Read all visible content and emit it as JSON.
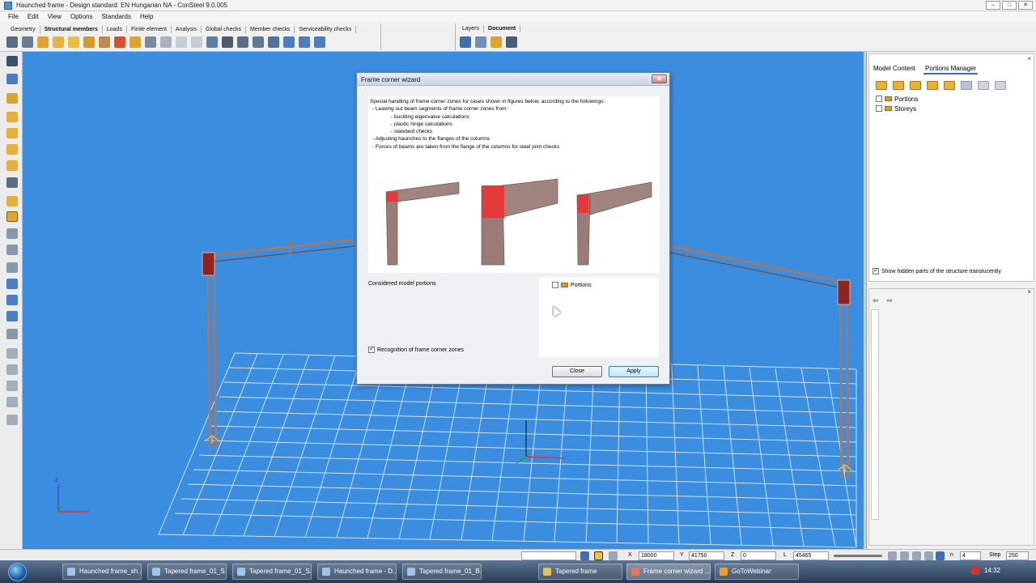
{
  "window": {
    "title": "Haunched frame - Design standard: EN Hungarian NA - ConSteel 9.0.005",
    "controls": [
      "–",
      "□",
      "✕"
    ]
  },
  "menu": [
    "File",
    "Edit",
    "View",
    "Options",
    "Standards",
    "Help"
  ],
  "ribbon": {
    "tabs": [
      "Geometry",
      "Structural members",
      "Loads",
      "Finite element",
      "Analysis",
      "Global checks",
      "Member checks",
      "Serviceability checks"
    ],
    "active_tab": "Structural members",
    "right_tabs": [
      "Layers",
      "Document"
    ]
  },
  "right_panel": {
    "tabs": [
      "Model Content",
      "Portions Manager"
    ],
    "active_tab": "Portions Manager",
    "tree": [
      {
        "label": "Portions",
        "checked": false
      },
      {
        "label": "Storeys",
        "checked": false
      }
    ],
    "show_hidden_label": "Show hidden parts of the structure translucently",
    "show_hidden_checked": true,
    "close_glyph": "×",
    "nav_back": "⇦",
    "nav_forward": "⇨"
  },
  "dialog": {
    "title": "Frame corner wizard",
    "close_glyph": "✕",
    "info_lines": [
      {
        "text": "Special handling of frame corner zones for cases shown in figures below, according to the followings:",
        "indent": 0
      },
      {
        "text": "- Leaving out beam segments of frame corner zones from:",
        "indent": 1
      },
      {
        "text": "- buckling eigenvalue calculations",
        "indent": 2
      },
      {
        "text": "- plastic hinge calculations",
        "indent": 2
      },
      {
        "text": "- standard checks",
        "indent": 2
      },
      {
        "text": "- Adjusting haunches to the flanges of the columns",
        "indent": 1
      },
      {
        "text": "- Forces of beams are taken from the flange of the columns for steel joint checks",
        "indent": 1
      }
    ],
    "considered_label": "Considered model portions",
    "portions_item": "Portions",
    "portions_checked": false,
    "recognition_label": "Recognition of frame corner zones",
    "recognition_checked": true,
    "close_button": "Close",
    "apply_button": "Apply"
  },
  "status": {
    "x_label": "X",
    "x_value": "18000",
    "y_label": "Y",
    "y_value": "41750",
    "z_label": "Z",
    "z_value": "0",
    "l_label": "L",
    "l_value": "45465",
    "n_value": "4",
    "step_label": "Step",
    "step_value": "250"
  },
  "axes": {
    "z": "z"
  },
  "taskbar": {
    "items": [
      "Haunched frame_sh...",
      "Tapered frame_01_S...",
      "Tapered frame_01_S...",
      "Haunched frame - D...",
      "Tapered frame_01_B...",
      "Tapered frame",
      "Frame corner wizard ...",
      "GoToWebinar"
    ],
    "active_index": 6,
    "clock": "14:32"
  },
  "colors": {
    "viewport_bg": "#3b8de0",
    "grid_line": "#d6e7fb",
    "frame_member": "#9a7a74",
    "corner_highlight": "#e53030",
    "dialog_border": "#6c7f99"
  }
}
